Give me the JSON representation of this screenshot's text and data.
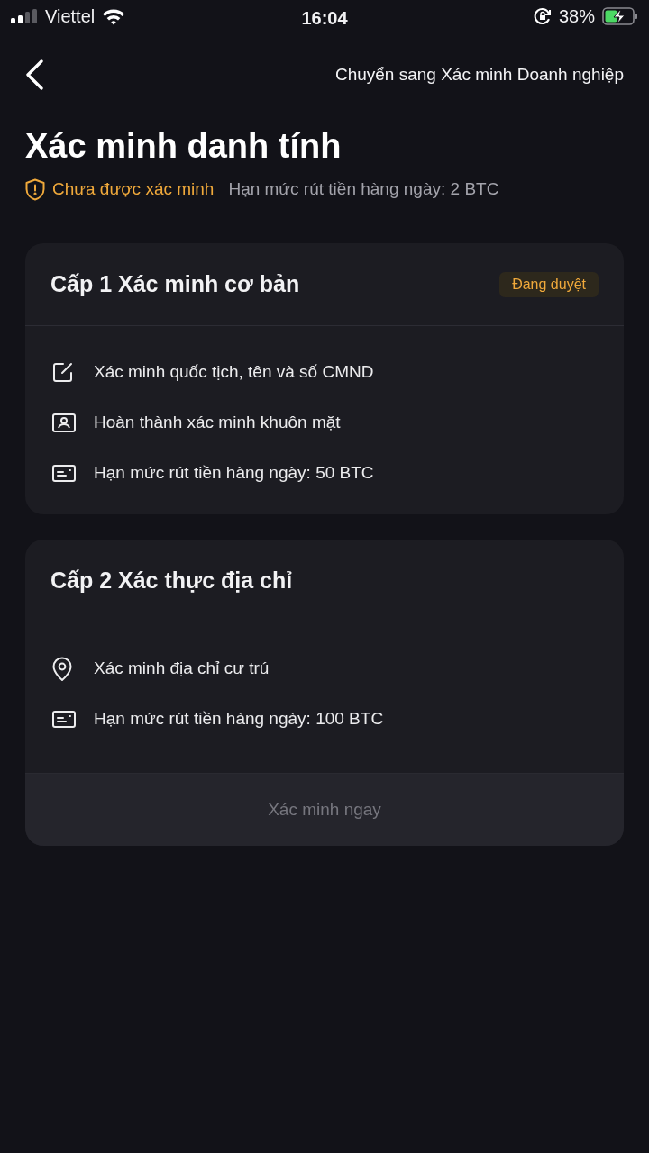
{
  "status_bar": {
    "carrier": "Viettel",
    "time": "16:04",
    "battery": "38%"
  },
  "header": {
    "link": "Chuyển sang Xác minh Doanh nghiệp"
  },
  "title": "Xác minh danh tính",
  "verification": {
    "status": "Chưa được xác minh",
    "limit": "Hạn mức rút tiền hàng ngày: 2 BTC"
  },
  "levels": [
    {
      "title": "Cấp 1 Xác minh cơ bản",
      "badge": "Đang duyệt",
      "items": [
        {
          "kind": "edit",
          "text": "Xác minh quốc tịch, tên và số CMND"
        },
        {
          "kind": "face",
          "text": "Hoàn thành xác minh khuôn mặt"
        },
        {
          "kind": "card",
          "text": "Hạn mức rút tiền hàng ngày: 50 BTC"
        }
      ]
    },
    {
      "title": "Cấp 2 Xác thực địa chỉ",
      "items": [
        {
          "kind": "location",
          "text": "Xác minh địa chỉ cư trú"
        },
        {
          "kind": "card",
          "text": "Hạn mức rút tiền hàng ngày: 100 BTC"
        }
      ],
      "button": {
        "label": "Xác minh ngay",
        "disabled": true
      }
    }
  ]
}
